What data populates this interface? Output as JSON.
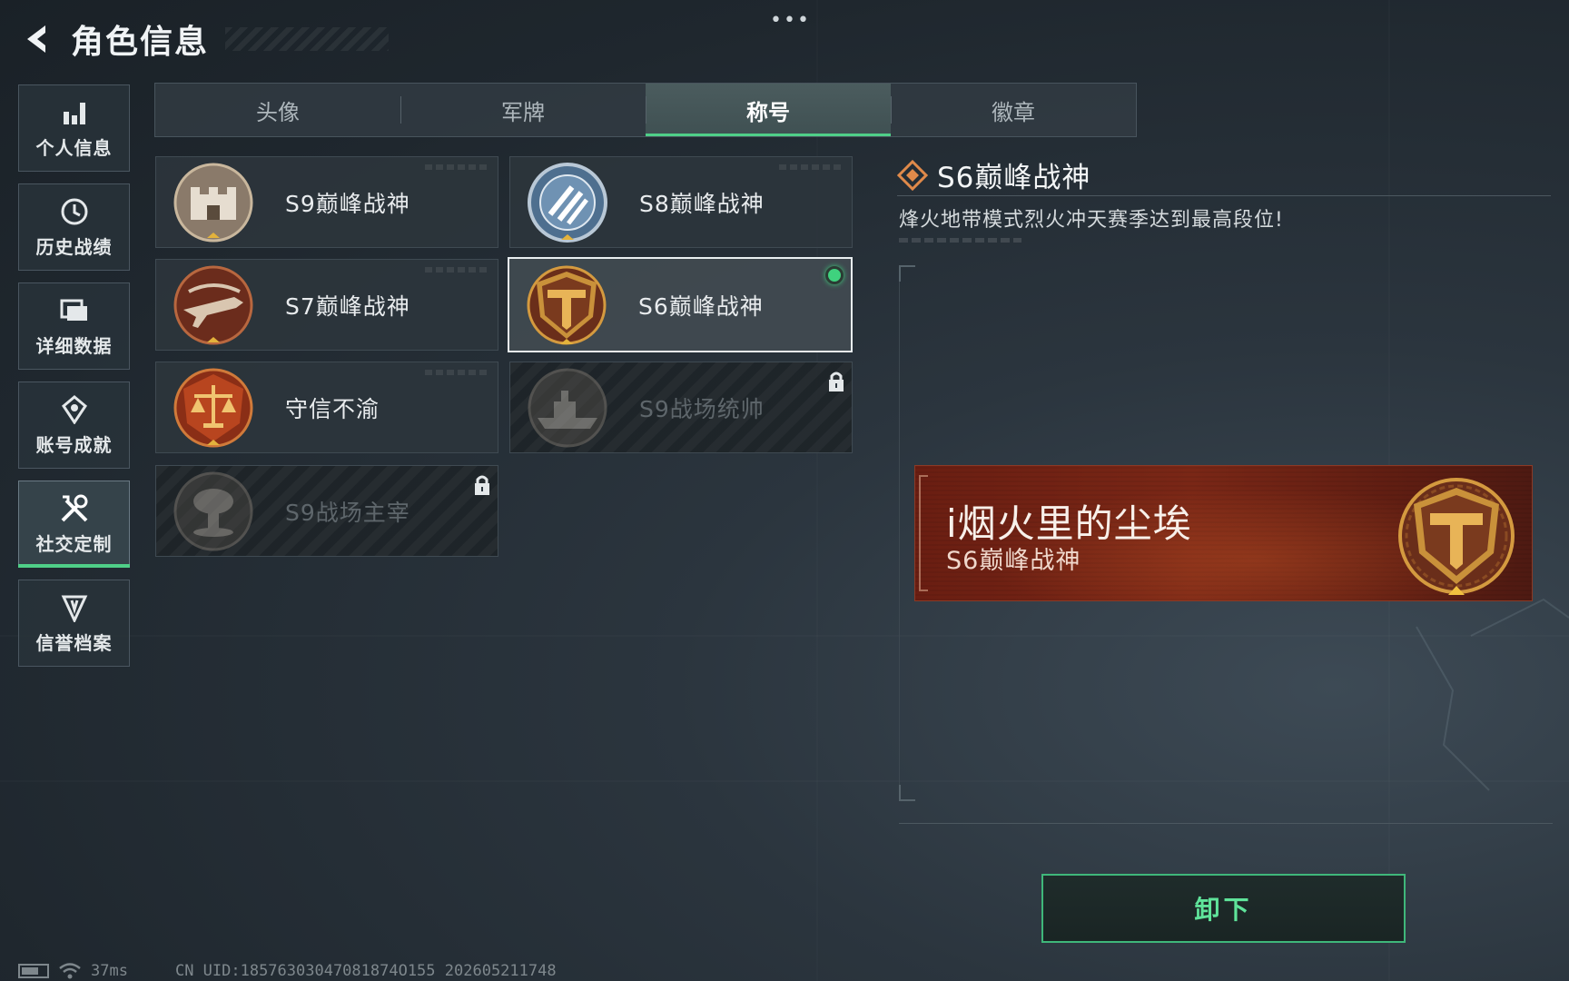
{
  "header": {
    "title": "角色信息"
  },
  "sidebar": {
    "items": [
      {
        "label": "个人信息",
        "icon": "bar-chart-icon",
        "active": false
      },
      {
        "label": "历史战绩",
        "icon": "clock-icon",
        "active": false
      },
      {
        "label": "详细数据",
        "icon": "folder-icon",
        "active": false
      },
      {
        "label": "账号成就",
        "icon": "achievement-icon",
        "active": false
      },
      {
        "label": "社交定制",
        "icon": "tools-icon",
        "active": true
      },
      {
        "label": "信誉档案",
        "icon": "credit-shield-icon",
        "active": false
      }
    ]
  },
  "tabs": [
    {
      "label": "头像",
      "active": false
    },
    {
      "label": "军牌",
      "active": false
    },
    {
      "label": "称号",
      "active": true
    },
    {
      "label": "徽章",
      "active": false
    }
  ],
  "titles": [
    {
      "name": "S9巅峰战神",
      "medal": "fortress-medal-icon",
      "state": "owned"
    },
    {
      "name": "S8巅峰战神",
      "medal": "blue-stripe-medal-icon",
      "state": "owned"
    },
    {
      "name": "S7巅峰战神",
      "medal": "rifle-medal-icon",
      "state": "owned"
    },
    {
      "name": "S6巅峰战神",
      "medal": "gold-t-medal-icon",
      "state": "equipped"
    },
    {
      "name": "守信不渝",
      "medal": "scales-medal-icon",
      "state": "owned"
    },
    {
      "name": "S9战场统帅",
      "medal": "warship-medal-icon",
      "state": "locked"
    },
    {
      "name": "S9战场主宰",
      "medal": "mushroom-cloud-medal-icon",
      "state": "locked"
    }
  ],
  "detail": {
    "title": "S6巅峰战神",
    "description": "烽火地带模式烈火冲天赛季达到最高段位!",
    "banner_player": "i烟火里的尘埃",
    "banner_title": "S6巅峰战神"
  },
  "actions": {
    "unequip_label": "卸下"
  },
  "status_bar": {
    "ping": "37ms",
    "uid": "CN UID:18576303047081874O155 202605211748"
  },
  "colors": {
    "accent": "#4fcf88",
    "banner": "#7a2716",
    "gold": "#c9913a"
  }
}
